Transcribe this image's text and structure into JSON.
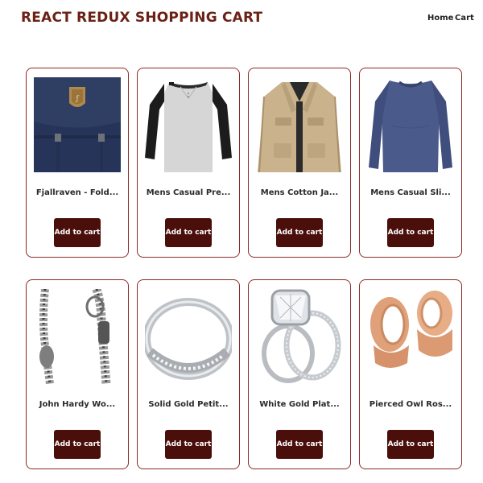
{
  "header": {
    "brand": "REACT REDUX SHOPPING CART",
    "nav": {
      "home": "Home",
      "cart": "Cart"
    }
  },
  "products": [
    {
      "title": "Fjallraven - Fold...",
      "image": "navy-backpack-image",
      "button": "Add to cart"
    },
    {
      "title": "Mens Casual Pre...",
      "image": "raglan-tshirt-image",
      "button": "Add to cart"
    },
    {
      "title": "Mens Cotton Ja...",
      "image": "khaki-jacket-image",
      "button": "Add to cart"
    },
    {
      "title": "Mens Casual Sli...",
      "image": "blue-longsleeve-image",
      "button": "Add to cart"
    },
    {
      "title": "John Hardy Wo...",
      "image": "chain-bracelet-image",
      "button": "Add to cart"
    },
    {
      "title": "Solid Gold Petit...",
      "image": "silver-ring-image",
      "button": "Add to cart"
    },
    {
      "title": "White Gold Plat...",
      "image": "diamond-ring-image",
      "button": "Add to cart"
    },
    {
      "title": "Pierced Owl Ros...",
      "image": "rose-gold-tunnels-image",
      "button": "Add to cart"
    }
  ],
  "colors": {
    "brand": "#6b2115",
    "card_border": "#8c2a25",
    "button_bg": "#4a0f0b",
    "button_text": "#ffffff"
  }
}
